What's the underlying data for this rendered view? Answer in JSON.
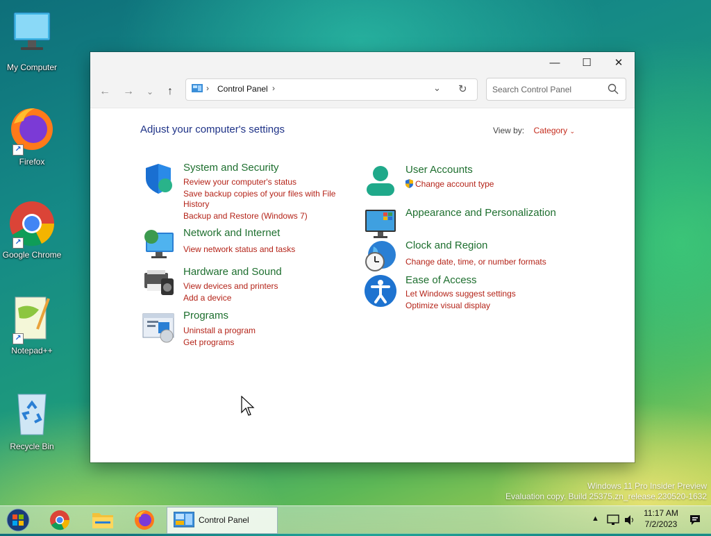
{
  "desktop": {
    "icons": [
      {
        "label": "My Computer"
      },
      {
        "label": "Firefox"
      },
      {
        "label": "Google Chrome"
      },
      {
        "label": "Notepad++"
      },
      {
        "label": "Recycle Bin"
      }
    ],
    "watermark": {
      "line1": "Windows 11 Pro Insider Preview",
      "line2": "Evaluation copy. Build 25375.zn_release.230520-1632"
    }
  },
  "window": {
    "controls": {
      "minimize": "—",
      "maximize": "☐",
      "close": "✕"
    },
    "nav": {
      "back": "←",
      "forward": "→",
      "recent": "⌄",
      "up": "↑"
    },
    "address": {
      "separator": "›",
      "location": "Control Panel",
      "trailing": "›",
      "dropdown": "⌄",
      "refresh": "↻"
    },
    "search": {
      "placeholder": "Search Control Panel"
    },
    "heading": "Adjust your computer's settings",
    "view_by": {
      "label": "View by:",
      "value": "Category"
    },
    "categories_left": [
      {
        "title": "System and Security",
        "links": [
          "Review your computer's status",
          "Save backup copies of your files with File",
          "History",
          "Backup and Restore (Windows 7)"
        ]
      },
      {
        "title": "Network and Internet",
        "links": [
          "View network status and tasks"
        ]
      },
      {
        "title": "Hardware and Sound",
        "links": [
          "View devices and printers",
          "Add a device"
        ]
      },
      {
        "title": "Programs",
        "links": [
          "Uninstall a program",
          "Get programs"
        ]
      }
    ],
    "categories_right": [
      {
        "title": "User Accounts",
        "links": [
          "Change account type"
        ]
      },
      {
        "title": "Appearance and Personalization",
        "links": []
      },
      {
        "title": "Clock and Region",
        "links": [
          "Change date, time, or number formats"
        ]
      },
      {
        "title": "Ease of Access",
        "links": [
          "Let Windows suggest settings",
          "Optimize visual display"
        ]
      }
    ]
  },
  "taskbar": {
    "active_window": "Control Panel",
    "time": "11:17 AM",
    "date": "7/2/2023"
  },
  "colors": {
    "heading": "#1e3287",
    "category_title": "#1e6f2f",
    "link": "#b42318"
  }
}
